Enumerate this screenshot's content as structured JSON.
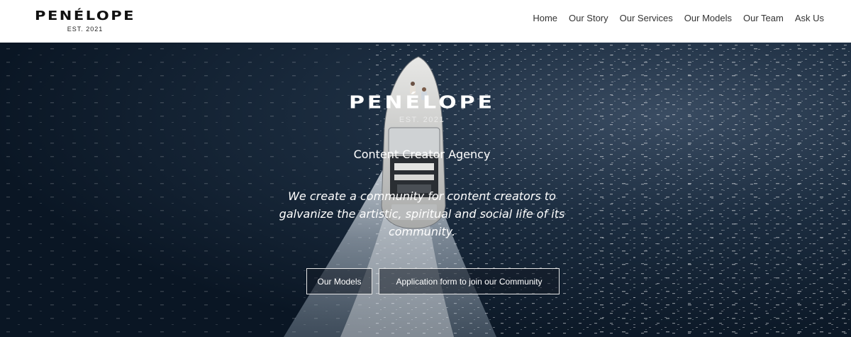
{
  "header": {
    "logo": {
      "word": "PENÉLOPE",
      "est": "EST. 2021"
    },
    "nav": [
      {
        "label": "Home"
      },
      {
        "label": "Our Story"
      },
      {
        "label": "Our Services"
      },
      {
        "label": "Our Models"
      },
      {
        "label": "Our Team"
      },
      {
        "label": "Ask Us"
      }
    ]
  },
  "hero": {
    "logo": {
      "word": "PENÉLOPE",
      "est": "EST. 2021"
    },
    "subtitle": "Content Creator Agency",
    "tagline": "We create a community for content creators to galvanize the artistic, spiritual and social life of its community.",
    "buttons": {
      "models_label": "Our Models",
      "apply_label": "Application form to join our Community"
    }
  },
  "colors": {
    "header_bg": "#ffffff",
    "nav_text": "#333333",
    "hero_water": "#0d1b2b",
    "hero_text": "#ffffff"
  }
}
